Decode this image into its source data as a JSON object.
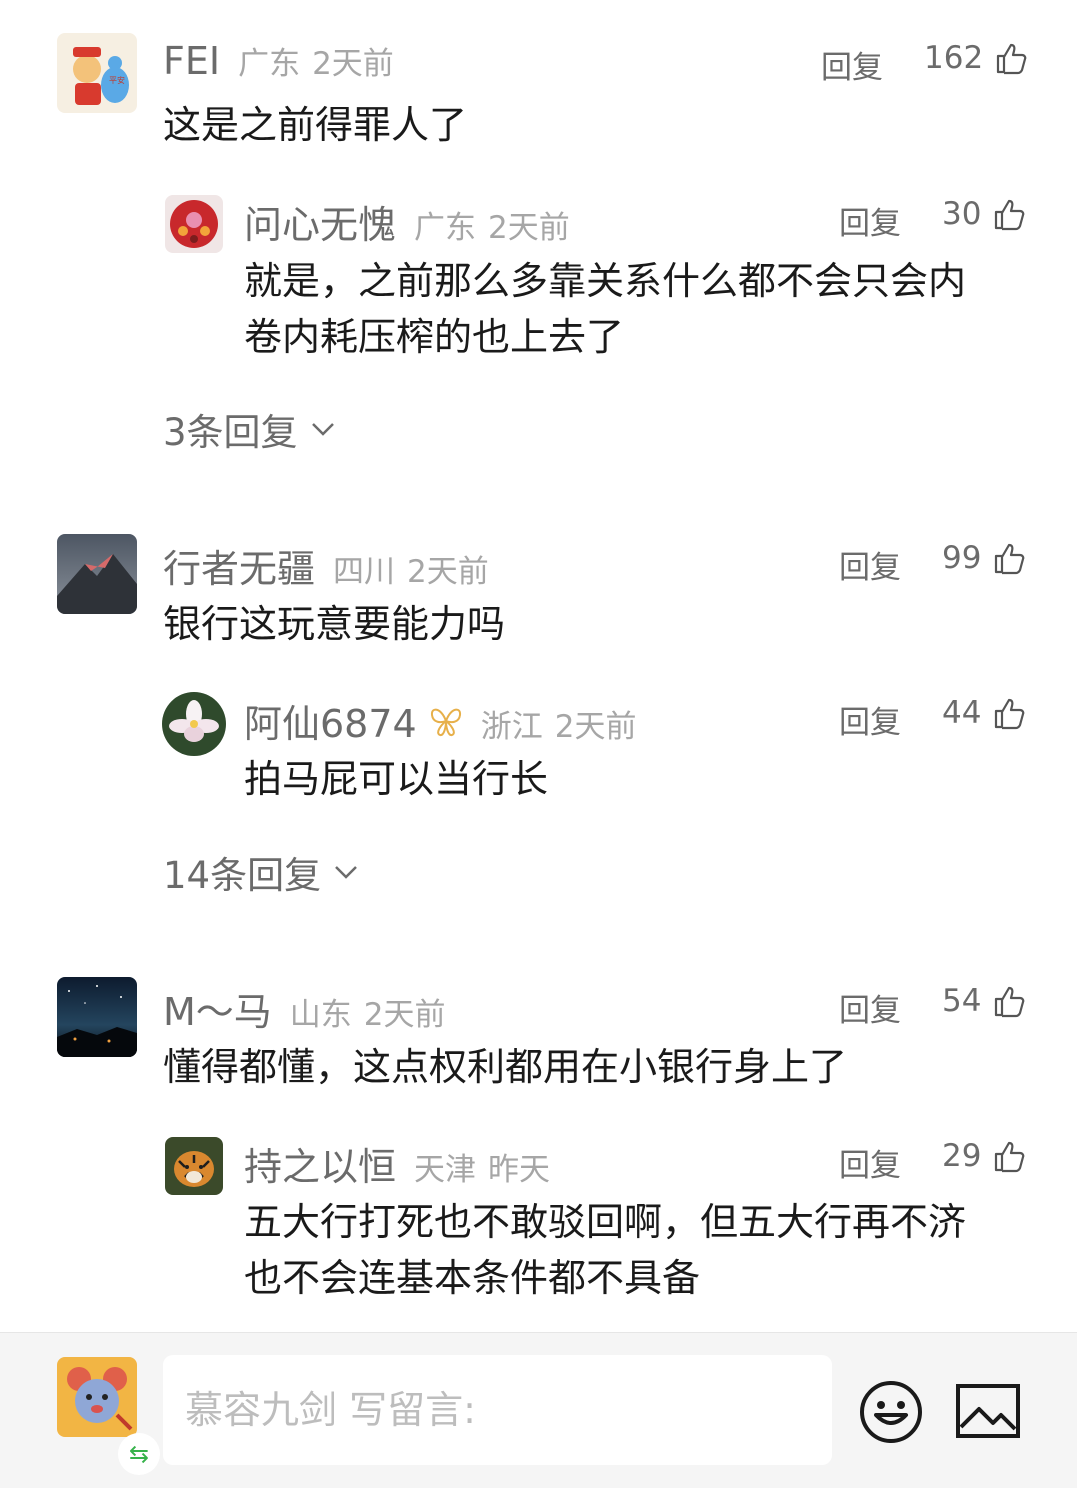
{
  "comments": [
    {
      "user": "FEI",
      "region": "广东",
      "time": "2天前",
      "reply_label": "回复",
      "likes": "162",
      "text": "这是之前得罪人了",
      "reply": {
        "user": "问心无愧",
        "region": "广东",
        "time": "2天前",
        "reply_label": "回复",
        "likes": "30",
        "text_lines": [
          "就是，之前那么多靠关系什么都不会只会内",
          "卷内耗压榨的也上去了"
        ]
      },
      "more_replies": "3条回复"
    },
    {
      "user": "行者无疆",
      "region": "四川",
      "time": "2天前",
      "reply_label": "回复",
      "likes": "99",
      "text": "银行这玩意要能力吗",
      "reply": {
        "user": "阿仙6874",
        "region": "浙江",
        "time": "2天前",
        "reply_label": "回复",
        "likes": "44",
        "text_lines": [
          "拍马屁可以当行长"
        ]
      },
      "more_replies": "14条回复"
    },
    {
      "user": "M～马",
      "region": "山东",
      "time": "2天前",
      "reply_label": "回复",
      "likes": "54",
      "text": "懂得都懂，这点权利都用在小银行身上了",
      "reply": {
        "user": "持之以恒",
        "region": "天津",
        "time": "昨天",
        "reply_label": "回复",
        "likes": "29",
        "text_lines": [
          "五大行打死也不敢驳回啊，但五大行再不济",
          "也不会连基本条件都不具备"
        ]
      }
    }
  ],
  "composer": {
    "placeholder": "慕容九剑 写留言:",
    "swap_glyph": "⇆"
  },
  "icons": {
    "like": "thumbs-up-icon",
    "expand": "chevron-down-icon",
    "emoji": "smiley-icon",
    "image": "image-icon",
    "badge": "butterfly-badge-icon",
    "accent_color": "#36b24a",
    "badge_color": "#e7b04a"
  }
}
